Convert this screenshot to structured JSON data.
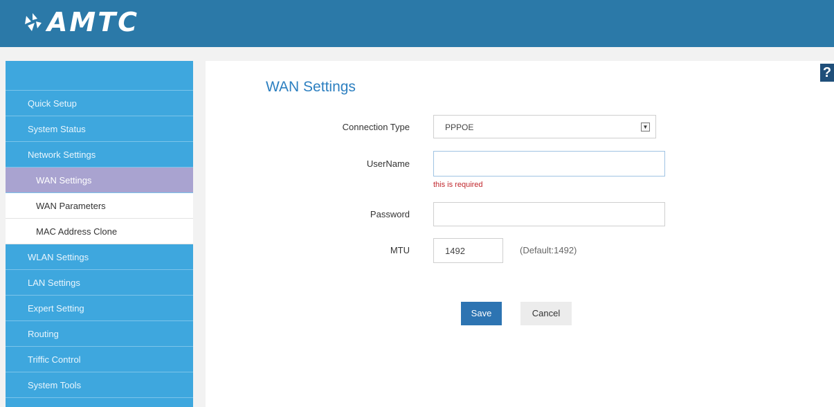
{
  "brand": {
    "name": "AMTC",
    "color": "#2b79a8"
  },
  "sidebar": {
    "items": [
      {
        "label": "Quick Setup"
      },
      {
        "label": "System Status"
      },
      {
        "label": "Network Settings"
      },
      {
        "label": "WAN Settings",
        "active": true
      },
      {
        "label": "WAN Parameters",
        "sub": true
      },
      {
        "label": "MAC Address Clone",
        "sub": true
      },
      {
        "label": "WLAN Settings"
      },
      {
        "label": "LAN Settings"
      },
      {
        "label": "Expert Setting"
      },
      {
        "label": "Routing"
      },
      {
        "label": "Triffic Control"
      },
      {
        "label": "System Tools"
      }
    ]
  },
  "help": {
    "icon": "help-icon",
    "text": "?"
  },
  "page": {
    "title": "WAN Settings"
  },
  "form": {
    "connection_type": {
      "label": "Connection Type",
      "value": "PPPOE"
    },
    "username": {
      "label": "UserName",
      "value": "",
      "error": "this is required"
    },
    "password": {
      "label": "Password",
      "value": ""
    },
    "mtu": {
      "label": "MTU",
      "value": "1492",
      "hint": "(Default:1492)"
    }
  },
  "buttons": {
    "save": "Save",
    "cancel": "Cancel"
  }
}
